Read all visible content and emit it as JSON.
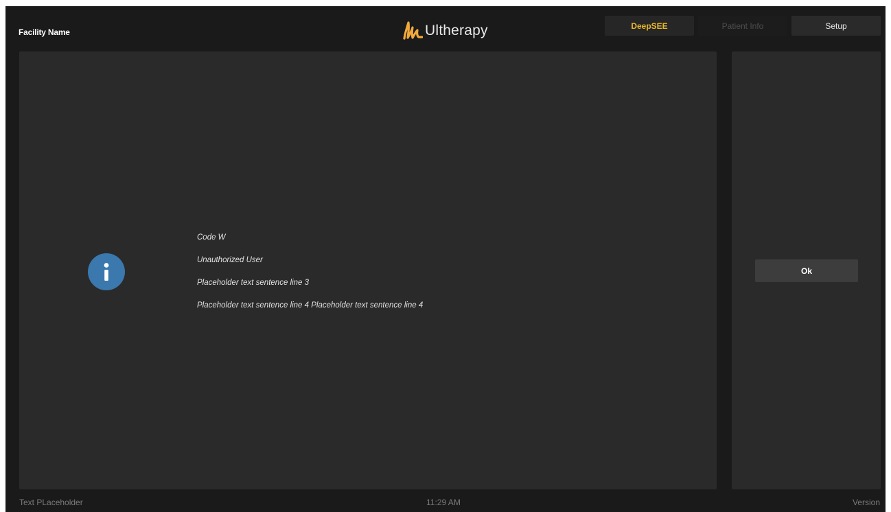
{
  "header": {
    "facility_name": "Facility Name",
    "logo_icon": "ultherapy-logo-icon",
    "logo_text": "Ultherapy"
  },
  "tabs": [
    {
      "label": "DeepSEE",
      "state": "active",
      "color": "#e9b72c"
    },
    {
      "label": "Patient Info",
      "state": "disabled",
      "color": "#4d4d4d"
    },
    {
      "label": "Setup",
      "state": "normal",
      "color": "#e6e6e6"
    }
  ],
  "message": {
    "icon": "info-icon",
    "icon_color": "#3a78ae",
    "lines": [
      "Code W",
      "Unauthorized User",
      "Placeholder text sentence line 3",
      "Placeholder text sentence line 4 Placeholder text sentence line 4"
    ]
  },
  "actions": {
    "ok_label": "Ok"
  },
  "footer": {
    "left_text": "Text PLaceholder",
    "time": "11:29 AM",
    "version": "Version"
  },
  "colors": {
    "background": "#1a1a1a",
    "panel": "#2a2a2a",
    "accent": "#e9b72c"
  }
}
